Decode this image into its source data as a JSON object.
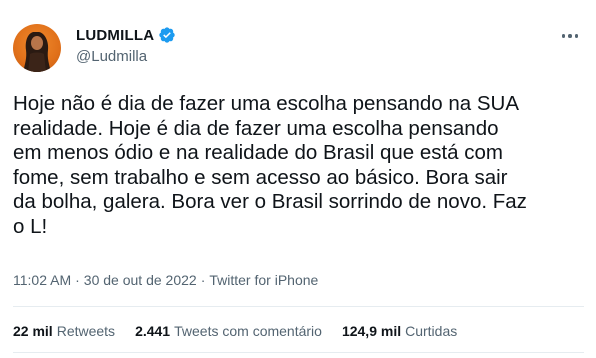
{
  "user": {
    "display_name": "LUDMILLA",
    "handle": "@Ludmilla",
    "verified_icon": "verified-badge-icon",
    "verified_color": "#1d9bf0"
  },
  "tweet": {
    "text": "Hoje não é dia de fazer uma escolha pensando na SUA\nrealidade. Hoje é dia de fazer uma escolha pensando\nem menos ódio e na realidade do Brasil que está com\nfome, sem trabalho e sem acesso ao básico. Bora sair\nda bolha, galera. Bora ver o Brasil sorrindo de novo. Faz\no L!",
    "time": "11:02 AM",
    "date": "30 de out de 2022",
    "separator": "·",
    "source": "Twitter for iPhone"
  },
  "stats": {
    "retweets_count": "22 mil",
    "retweets_label": "Retweets",
    "quotes_count": "2.441",
    "quotes_label": "Tweets com comentário",
    "likes_count": "124,9 mil",
    "likes_label": "Curtidas"
  },
  "colors": {
    "text": "#0f1419",
    "secondary": "#536471",
    "avatar_bg": "#e0701a"
  }
}
